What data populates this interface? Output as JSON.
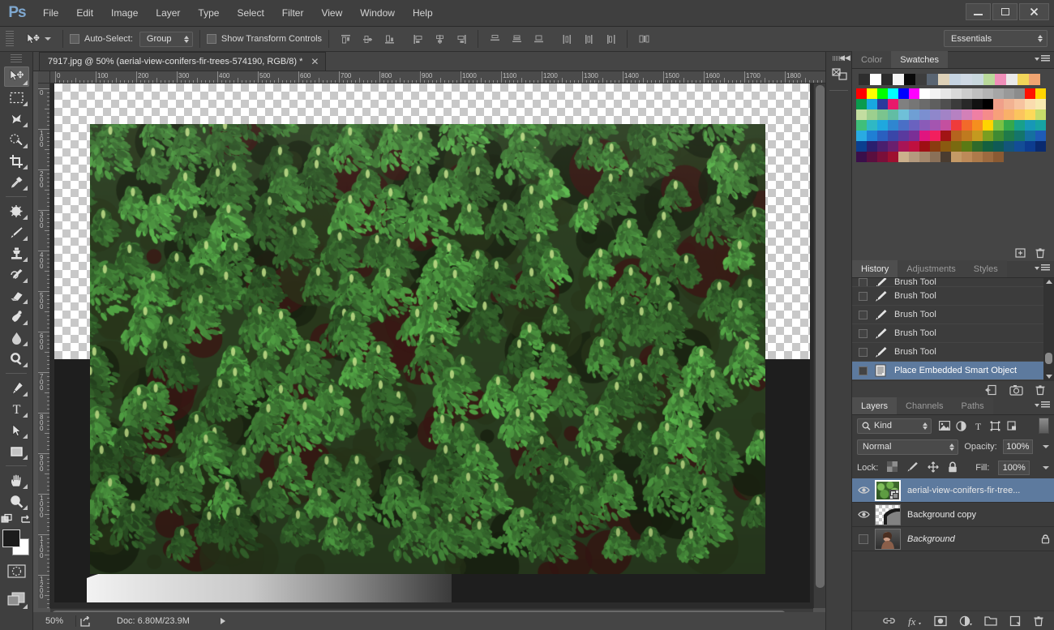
{
  "app": {
    "name": "Ps",
    "logo_color": "#7fa8d0"
  },
  "menubar": {
    "items": [
      "File",
      "Edit",
      "Image",
      "Layer",
      "Type",
      "Select",
      "Filter",
      "View",
      "Window",
      "Help"
    ]
  },
  "window_controls": {
    "minimize": "–",
    "maximize": "□",
    "close": "✕"
  },
  "options_bar": {
    "tool": "move-tool",
    "auto_select_label": "Auto-Select:",
    "auto_select_checked": false,
    "auto_select_value": "Group",
    "show_transform_label": "Show Transform Controls",
    "show_transform_checked": false,
    "align_icons": [
      "align-top-edges",
      "align-vertical-centers",
      "align-bottom-edges",
      "align-left-edges",
      "align-horizontal-centers",
      "align-right-edges",
      "distribute-top-edges",
      "distribute-vertical-centers",
      "distribute-bottom-edges",
      "distribute-left-edges",
      "distribute-horizontal-centers",
      "distribute-right-edges",
      "auto-align-layers"
    ],
    "workspace": "Essentials"
  },
  "toolbar": {
    "tools": [
      {
        "name": "move-tool",
        "active": true,
        "has_flyout": true
      },
      {
        "name": "rectangular-marquee-tool",
        "active": false,
        "has_flyout": true
      },
      {
        "name": "lasso-tool",
        "active": false,
        "has_flyout": true
      },
      {
        "name": "quick-selection-tool",
        "active": false,
        "has_flyout": true
      },
      {
        "name": "crop-tool",
        "active": false,
        "has_flyout": true
      },
      {
        "name": "eyedropper-tool",
        "active": false,
        "has_flyout": true
      },
      {
        "name": "spot-healing-brush-tool",
        "active": false,
        "has_flyout": true
      },
      {
        "name": "brush-tool",
        "active": false,
        "has_flyout": true
      },
      {
        "name": "clone-stamp-tool",
        "active": false,
        "has_flyout": true
      },
      {
        "name": "history-brush-tool",
        "active": false,
        "has_flyout": true
      },
      {
        "name": "eraser-tool",
        "active": false,
        "has_flyout": true
      },
      {
        "name": "gradient-tool",
        "active": false,
        "has_flyout": true
      },
      {
        "name": "blur-tool",
        "active": false,
        "has_flyout": true
      },
      {
        "name": "dodge-tool",
        "active": false,
        "has_flyout": true
      },
      {
        "name": "pen-tool",
        "active": false,
        "has_flyout": true
      },
      {
        "name": "horizontal-type-tool",
        "active": false,
        "has_flyout": true
      },
      {
        "name": "path-selection-tool",
        "active": false,
        "has_flyout": true
      },
      {
        "name": "rectangle-tool",
        "active": false,
        "has_flyout": true
      },
      {
        "name": "hand-tool",
        "active": false,
        "has_flyout": true
      },
      {
        "name": "zoom-tool",
        "active": false,
        "has_flyout": true
      }
    ],
    "foreground_color": "#1c1c1c",
    "background_color": "#ffffff",
    "quick_mask_name": "edit-in-quick-mask-mode",
    "screen_mode_name": "change-screen-mode"
  },
  "document": {
    "tab_title": "7917.jpg @ 50% (aerial-view-conifers-fir-trees-574190, RGB/8) *",
    "close_glyph": "✕",
    "zoom": "50%",
    "ruler_units_h": [
      "0",
      "100",
      "200",
      "300",
      "400",
      "500",
      "600",
      "700",
      "800",
      "900",
      "1000",
      "1100",
      "1200",
      "1300",
      "1400",
      "1500",
      "1600",
      "1700",
      "1800"
    ],
    "ruler_units_v": [
      "0",
      "100",
      "200",
      "300",
      "400",
      "500",
      "600",
      "700",
      "800",
      "900",
      "1000",
      "1100",
      "1200"
    ]
  },
  "status_bar": {
    "zoom": "50%",
    "doc_label": "Doc: 6.80M/23.9M",
    "share_icon": "share-icon",
    "expand_icon": "status-expand-arrow"
  },
  "color_panel": {
    "tabs": [
      {
        "label": "Color",
        "active": false
      },
      {
        "label": "Swatches",
        "active": true
      }
    ],
    "top_row": [
      "#2e2e2e",
      "#ffffff",
      "#2b2b2b",
      "#f4f4f4",
      "#0a0a0a",
      "#3d3d3d",
      "#5a6572",
      "#ded1b8",
      "#c6d4e2",
      "#cfd9e4",
      "#c9d8de",
      "#b9d99a",
      "#ef8fb9",
      "#e9e9e9",
      "#f2d55a",
      "#f0a471"
    ],
    "grid": [
      [
        "#ff0000",
        "#ffff00",
        "#00ff00",
        "#00ffff",
        "#0000ff",
        "#ff00ff",
        "#ffffff",
        "#f2f2f2",
        "#e6e6e6",
        "#d9d9d9",
        "#cccccc",
        "#bfbfbf",
        "#b3b3b3",
        "#a6a6a6",
        "#999999",
        "#8c8c8c",
        "#ff1100",
        "#ffd400"
      ],
      [
        "#0a9b4d",
        "#18a8e0",
        "#2a3a9c",
        "#e8196b",
        "#808080",
        "#767676",
        "#6b6b6b",
        "#5f5f5f",
        "#4f4f4f",
        "#3b3b3b",
        "#282828",
        "#111111",
        "#000000",
        "#f0a08a",
        "#f2b292",
        "#f7c39f",
        "#fadcae",
        "#f7eab0"
      ],
      [
        "#c3dda0",
        "#9ccf8e",
        "#7bc48e",
        "#62bda4",
        "#6fc0d8",
        "#6f9fd4",
        "#7b8fd0",
        "#8f87cb",
        "#a283c6",
        "#b681c2",
        "#d380b8",
        "#ef7fa4",
        "#f58b8b",
        "#f7a07a",
        "#f9b069",
        "#fbc45e",
        "#fbd95a",
        "#c6dc6a"
      ],
      [
        "#3fbf7a",
        "#2fb8c4",
        "#1fa8de",
        "#2f86d0",
        "#4a6fc6",
        "#6a62bf",
        "#8a5bb8",
        "#a455b0",
        "#c44f9f",
        "#ef3b3b",
        "#f26a2a",
        "#f58f1e",
        "#ffd400",
        "#7ac143",
        "#35a84b",
        "#18a08a",
        "#1798b6",
        "#17a3a3"
      ],
      [
        "#29abe2",
        "#1f7fd4",
        "#2a5fbf",
        "#3a46a8",
        "#5a3a9e",
        "#7a2f96",
        "#e0157f",
        "#f21f5e",
        "#a11414",
        "#b5641e",
        "#bf7a1f",
        "#c49a1f",
        "#7a9e20",
        "#3f8a32",
        "#1f7a4a",
        "#14756b",
        "#1570a0",
        "#1e5bb5"
      ],
      [
        "#0b3f8f",
        "#2a1f6e",
        "#4a1f6e",
        "#6a1f6e",
        "#a81456",
        "#bf1040",
        "#9e0f14",
        "#8a3c10",
        "#8a5a10",
        "#7a6a10",
        "#5a7a14",
        "#2f6a2a",
        "#14603f",
        "#0f5a56",
        "#13557a",
        "#134d96",
        "#0d3c8f",
        "#0a2a6e"
      ],
      [
        "#3a0f4a",
        "#5a0f3f",
        "#7a0f3a",
        "#9e1030",
        "#cbb08c",
        "#b49a7e",
        "#a3876c",
        "#8a7058",
        "#4a3c30",
        "#c49a66",
        "#bd8a58",
        "#ad7a4a",
        "#9c6a3f",
        "#8a5a33",
        "#ffffff00",
        "#ffffff00",
        "#ffffff00",
        "#ffffff00"
      ]
    ],
    "footer_icons": [
      "new-swatch-icon",
      "delete-swatch-icon"
    ]
  },
  "history_panel": {
    "tabs": [
      {
        "label": "History",
        "active": true
      },
      {
        "label": "Adjustments",
        "active": false
      },
      {
        "label": "Styles",
        "active": false
      }
    ],
    "items": [
      {
        "label": "Brush Tool",
        "icon": "brush-tool-icon",
        "selected": false,
        "partial": true
      },
      {
        "label": "Brush Tool",
        "icon": "brush-tool-icon",
        "selected": false
      },
      {
        "label": "Brush Tool",
        "icon": "brush-tool-icon",
        "selected": false
      },
      {
        "label": "Brush Tool",
        "icon": "brush-tool-icon",
        "selected": false
      },
      {
        "label": "Brush Tool",
        "icon": "brush-tool-icon",
        "selected": false
      },
      {
        "label": "Place Embedded Smart Object",
        "icon": "smart-object-icon",
        "selected": true
      }
    ],
    "footer_icons": [
      "create-document-from-state-icon",
      "create-new-snapshot-icon",
      "delete-state-icon"
    ]
  },
  "layers_panel": {
    "tabs": [
      {
        "label": "Layers",
        "active": true
      },
      {
        "label": "Channels",
        "active": false
      },
      {
        "label": "Paths",
        "active": false
      }
    ],
    "filter_kind": "Kind",
    "filter_icons": [
      "filter-pixel-icon",
      "filter-adjustment-icon",
      "filter-type-icon",
      "filter-shape-icon",
      "filter-smart-object-icon"
    ],
    "blend_mode": "Normal",
    "opacity_label": "Opacity:",
    "opacity_value": "100%",
    "lock_label": "Lock:",
    "lock_icons": [
      "lock-transparent-pixels-icon",
      "lock-image-pixels-icon",
      "lock-position-icon",
      "lock-all-icon"
    ],
    "fill_label": "Fill:",
    "fill_value": "100%",
    "layers": [
      {
        "name": "aerial-view-conifers-fir-tree...",
        "visible": true,
        "selected": true,
        "locked": false,
        "italic": false,
        "smart_object": true,
        "thumb": "forest"
      },
      {
        "name": "Background copy",
        "visible": true,
        "selected": false,
        "locked": false,
        "italic": false,
        "smart_object": false,
        "thumb": "mask"
      },
      {
        "name": "Background",
        "visible": false,
        "selected": false,
        "locked": true,
        "italic": true,
        "smart_object": false,
        "thumb": "portrait"
      }
    ],
    "footer_icons": [
      "link-layers-icon",
      "layer-style-fx-icon",
      "add-layer-mask-icon",
      "new-adjustment-layer-icon",
      "new-group-icon",
      "new-layer-icon",
      "delete-layer-icon"
    ]
  },
  "dock": {
    "collapse_icon": "collapse-to-icons-icon",
    "icon_items": [
      "libraries-panel-icon"
    ]
  }
}
